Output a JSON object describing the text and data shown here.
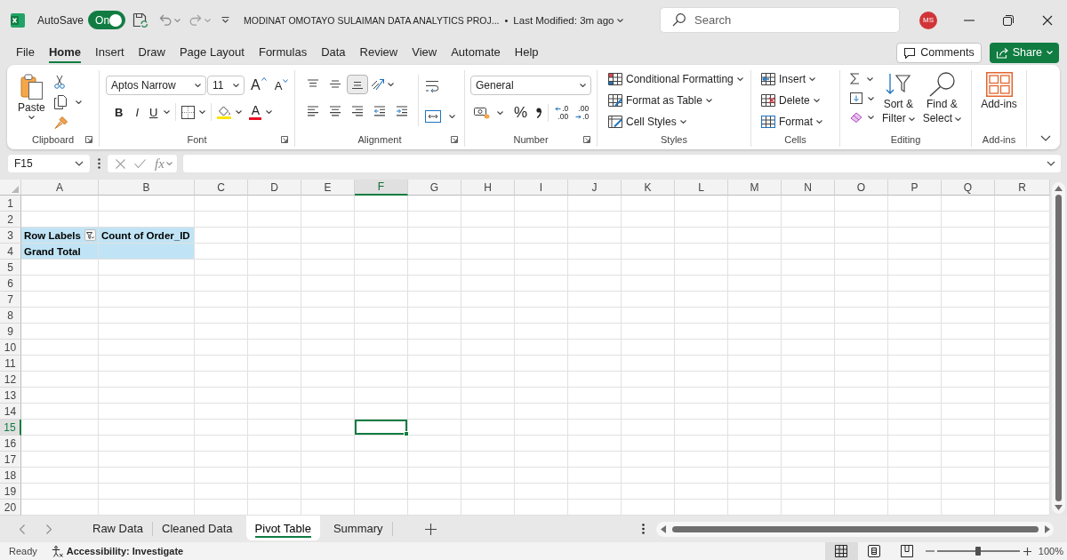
{
  "title_bar": {
    "autosave": {
      "label": "AutoSave",
      "state": "On",
      "on": true
    },
    "title": "MODINAT OMOTAYO SULAIMAN DATA ANALYTICS PROJ...",
    "separator": "•",
    "modified": "Last Modified: 3m ago",
    "search": {
      "placeholder": "Search"
    },
    "avatar": "MS"
  },
  "menu_tabs": [
    {
      "label": "File",
      "selected": false
    },
    {
      "label": "Home",
      "selected": true
    },
    {
      "label": "Insert",
      "selected": false
    },
    {
      "label": "Draw",
      "selected": false
    },
    {
      "label": "Page Layout",
      "selected": false
    },
    {
      "label": "Formulas",
      "selected": false
    },
    {
      "label": "Data",
      "selected": false
    },
    {
      "label": "Review",
      "selected": false
    },
    {
      "label": "View",
      "selected": false
    },
    {
      "label": "Automate",
      "selected": false
    },
    {
      "label": "Help",
      "selected": false
    }
  ],
  "actions": {
    "comments": "Comments",
    "share": "Share"
  },
  "ribbon": {
    "clipboard": {
      "paste": "Paste",
      "label": "Clipboard"
    },
    "font": {
      "name": "Aptos Narrow",
      "size": "11",
      "grow": "A",
      "shrink": "A",
      "bold": "B",
      "italic": "I",
      "underline": "U",
      "font_color": "A",
      "label": "Font"
    },
    "alignment": {
      "vertical": [
        {
          "kind": "top",
          "selected": false
        },
        {
          "kind": "middle",
          "selected": false
        },
        {
          "kind": "bottom",
          "selected": true
        }
      ],
      "horizontal": [
        {
          "kind": "left",
          "selected": false
        },
        {
          "kind": "center",
          "selected": false
        },
        {
          "kind": "right",
          "selected": false
        }
      ],
      "label": "Alignment"
    },
    "number": {
      "format": "General",
      "percent": "%",
      "increase_decimal": {
        "top": ".0",
        "bottom": ".00"
      },
      "decrease_decimal": {
        "top": ".00",
        "bottom": ".0"
      },
      "label": "Number"
    },
    "styles": {
      "items": [
        {
          "kind": "conditional",
          "label": "Conditional Formatting"
        },
        {
          "kind": "table",
          "label": "Format as Table"
        },
        {
          "kind": "cell",
          "label": "Cell Styles"
        }
      ],
      "label": "Styles"
    },
    "cells": {
      "items": [
        {
          "kind": "insert",
          "label": "Insert"
        },
        {
          "kind": "delete",
          "label": "Delete"
        },
        {
          "kind": "format",
          "label": "Format"
        }
      ],
      "label": "Cells"
    },
    "editing": {
      "sort_filter": [
        "Sort &",
        "Filter"
      ],
      "find_select": [
        "Find &",
        "Select"
      ],
      "label": "Editing"
    },
    "add_ins": {
      "button": "Add-ins",
      "label": "Add-ins"
    }
  },
  "formula_bar": {
    "name_box": "F15",
    "function": "fx"
  },
  "sheet": {
    "columns": [
      {
        "label": "A",
        "selected": false
      },
      {
        "label": "B",
        "selected": false
      },
      {
        "label": "C",
        "selected": false
      },
      {
        "label": "D",
        "selected": false
      },
      {
        "label": "E",
        "selected": false
      },
      {
        "label": "F",
        "selected": true
      },
      {
        "label": "G",
        "selected": false
      },
      {
        "label": "H",
        "selected": false
      },
      {
        "label": "I",
        "selected": false
      },
      {
        "label": "J",
        "selected": false
      },
      {
        "label": "K",
        "selected": false
      },
      {
        "label": "L",
        "selected": false
      },
      {
        "label": "M",
        "selected": false
      },
      {
        "label": "N",
        "selected": false
      },
      {
        "label": "O",
        "selected": false
      },
      {
        "label": "P",
        "selected": false
      },
      {
        "label": "Q",
        "selected": false
      },
      {
        "label": "R",
        "selected": false
      }
    ],
    "rows": [
      {
        "label": "1",
        "selected": false
      },
      {
        "label": "2",
        "selected": false
      },
      {
        "label": "3",
        "selected": false,
        "cells": [
          {
            "kind": "pivot",
            "text": "Row Labels",
            "filter_button": true
          },
          {
            "kind": "pivot",
            "text": "Count of Order_ID"
          }
        ]
      },
      {
        "label": "4",
        "selected": false,
        "cells": [
          {
            "kind": "pivot",
            "text": "Grand Total"
          },
          {
            "kind": "pivot"
          }
        ]
      },
      {
        "label": "5",
        "selected": false
      },
      {
        "label": "6",
        "selected": false
      },
      {
        "label": "7",
        "selected": false
      },
      {
        "label": "8",
        "selected": false
      },
      {
        "label": "9",
        "selected": false
      },
      {
        "label": "10",
        "selected": false
      },
      {
        "label": "11",
        "selected": false
      },
      {
        "label": "12",
        "selected": false
      },
      {
        "label": "13",
        "selected": false
      },
      {
        "label": "14",
        "selected": false
      },
      {
        "label": "15",
        "selected": true
      },
      {
        "label": "16",
        "selected": false
      },
      {
        "label": "17",
        "selected": false
      },
      {
        "label": "18",
        "selected": false
      },
      {
        "label": "19",
        "selected": false
      },
      {
        "label": "20",
        "selected": false
      }
    ]
  },
  "sheet_tabs": [
    {
      "label": "Raw Data",
      "selected": false
    },
    {
      "label": "Cleaned Data",
      "selected": false
    },
    {
      "label": "Pivot Table",
      "selected": true
    },
    {
      "label": "Summary",
      "selected": false
    }
  ],
  "status_bar": {
    "mode": "Ready",
    "accessibility": "Accessibility: Investigate",
    "views": [
      {
        "kind": "normal",
        "selected": true
      },
      {
        "kind": "page-layout",
        "selected": false
      },
      {
        "kind": "page-break",
        "selected": false
      }
    ],
    "zoom": {
      "level": 0.5,
      "reading": "100%"
    }
  }
}
